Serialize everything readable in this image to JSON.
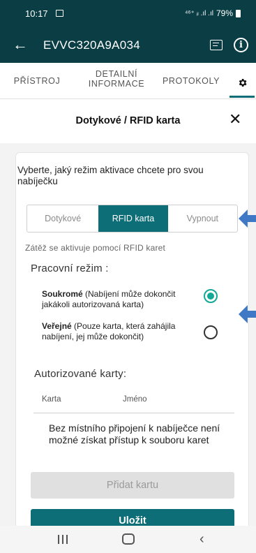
{
  "status_bar": {
    "time": "10:17",
    "signal": "⁴⁶⁺ ᵢₗ .ıl .ıl",
    "battery": "79%"
  },
  "app_bar": {
    "title": "EVVC320A9A034",
    "back_icon": "arrow-left-icon",
    "doc_icon": "document-icon",
    "info_icon": "info-icon",
    "color": "#0a3d44"
  },
  "tabs": [
    {
      "label": "PŘÍSTROJ"
    },
    {
      "label_line1": "DETAILNÍ",
      "label_line2": "INFORMACE"
    },
    {
      "label": "PROTOKOLY"
    },
    {
      "icon": "gear-icon",
      "active": true
    }
  ],
  "sheet": {
    "title": "Dotykové / RFID karta",
    "intro": "Vyberte, jaký režim aktivace chcete pro svou nabíječku",
    "segments": [
      "Dotykové",
      "RFID karta",
      "Vypnout"
    ],
    "selected_segment": "RFID karta",
    "hint": "Zátěž se aktivuje pomocí RFID karet",
    "mode_label": "Pracovní režim :",
    "options": [
      {
        "bold": "Soukromé",
        "rest": " (Nabíjení může dokončit jakákoli autorizovaná karta)",
        "selected": true
      },
      {
        "bold": "Veřejné",
        "rest": " (Pouze karta, která zahájila nabíjení, jej může dokončit)",
        "selected": false
      }
    ],
    "cards_title": "Autorizované karty:",
    "columns": [
      "Karta",
      "Jméno"
    ],
    "no_cards_text": "Bez místního připojení k nabíječce není možné získat přístup k souboru karet",
    "add_button": "Přidat kartu",
    "save_button": "Uložit"
  },
  "colors": {
    "accent": "#0e6e78",
    "radio": "#14a896",
    "annotation_arrow": "#3f78c4"
  }
}
